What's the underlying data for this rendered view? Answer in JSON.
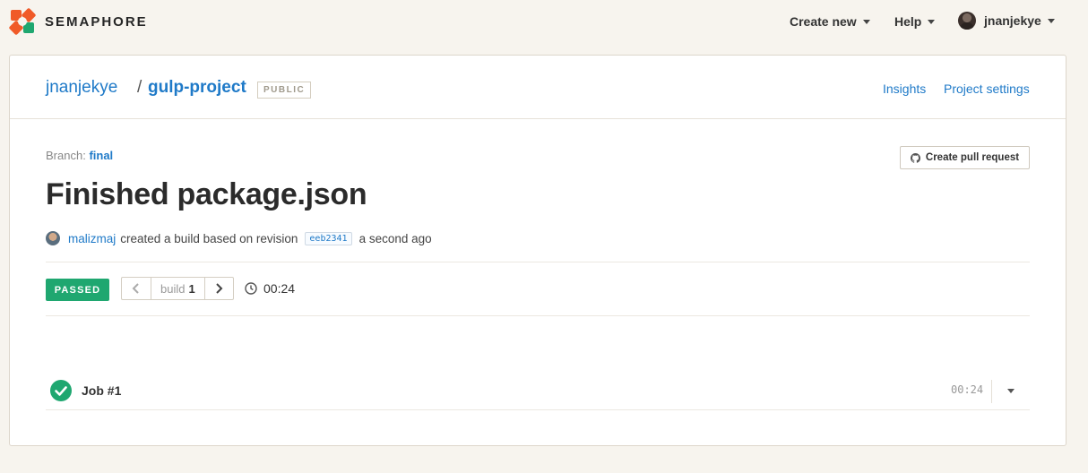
{
  "brand": {
    "name": "SEMAPHORE",
    "colors": {
      "orange": "#f05a28",
      "green": "#1fa770"
    }
  },
  "nav": {
    "create_new": "Create new",
    "help": "Help",
    "user": "jnanjekye"
  },
  "project": {
    "owner": "jnanjekye",
    "slash": "/",
    "name": "gulp-project",
    "visibility": "PUBLIC",
    "links": {
      "insights": "Insights",
      "settings": "Project settings"
    }
  },
  "build": {
    "branch_label": "Branch:",
    "branch": "final",
    "create_pr": "Create pull request",
    "title": "Finished package.json",
    "author": "malizmaj",
    "created_text": "created a build based on revision",
    "revision": "eeb2341",
    "time_ago": "a second ago",
    "status": "PASSED",
    "build_label": "build",
    "build_number": "1",
    "duration": "00:24"
  },
  "jobs": [
    {
      "name": "Job #1",
      "duration": "00:24",
      "status": "passed"
    }
  ]
}
